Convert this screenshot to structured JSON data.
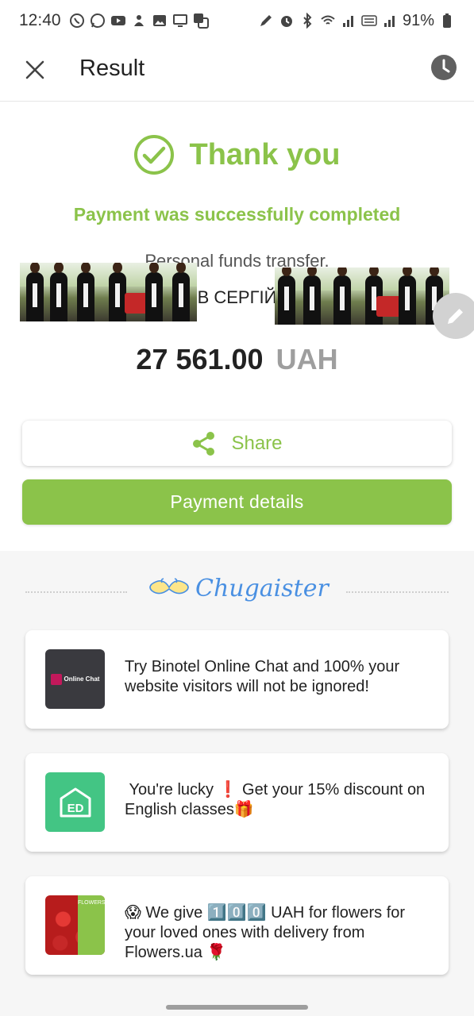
{
  "status_bar": {
    "time": "12:40",
    "battery": "91%",
    "left_icons": [
      "viber-icon",
      "whatsapp-icon",
      "youtube-icon",
      "notification-icon",
      "gallery-icon",
      "screen-icon",
      "translate-icon"
    ],
    "right_icons": [
      "pen-icon",
      "alarm-icon",
      "bluetooth-icon",
      "wifi-icon",
      "signal-icon",
      "volte-icon",
      "signal-icon",
      "battery-icon"
    ]
  },
  "app_bar": {
    "title": "Result"
  },
  "result": {
    "heading": "Thank you",
    "subtitle": "Payment was successfully completed",
    "purpose": "Personal funds transfer.",
    "recipient": "В СЕРГІЙ",
    "amount": "27 561.00",
    "currency": "UAH"
  },
  "actions": {
    "share_label": "Share",
    "details_label": "Payment details"
  },
  "promo": {
    "brand_name": "Chugaister",
    "cards": [
      {
        "thumb_label": "Online Chat",
        "text": "Try Binotel Online Chat and 100% your website visitors will not be ignored!"
      },
      {
        "thumb_label": "ED",
        "text": " You're lucky ❗ Get your 15% discount on English classes🎁"
      },
      {
        "thumb_label": "FLOWERS.UA",
        "text": "😱 We give 1️⃣0️⃣0️⃣ UAH for flowers for your loved ones with delivery from Flowers.ua 🌹"
      }
    ]
  },
  "colors": {
    "accent": "#8bc34a",
    "text": "#222222",
    "muted": "#9e9e9e",
    "brand_blue": "#4a90e2",
    "promo_bg": "#f6f6f6"
  }
}
